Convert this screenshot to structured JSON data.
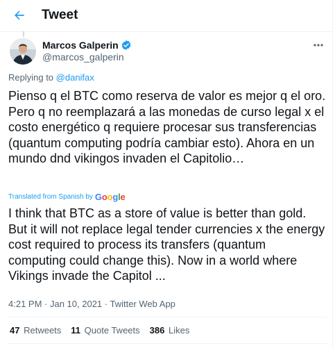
{
  "header": {
    "title": "Tweet"
  },
  "author": {
    "name": "Marcos Galperin",
    "handle": "@marcos_galperin"
  },
  "replying": {
    "prefix": "Replying to ",
    "handle": "@danifax"
  },
  "tweet": {
    "text": "Pienso q el BTC como reserva de valor es mejor q el oro. Pero q no reemplazará a las monedas de curso legal x el costo energético q requiere procesar sus transferencias (quantum computing podría cambiar esto). Ahora en un mundo dnd vikingos invaden el Capitolio…"
  },
  "translation": {
    "label": "Translated from Spanish by",
    "provider": "Google",
    "text": "I think that BTC as a store of value is better than gold. But it will not replace legal tender currencies x the energy cost required to process its transfers (quantum computing could change this). Now in a world where Vikings invade the Capitol ..."
  },
  "meta": {
    "time": "4:21 PM",
    "sep1": " · ",
    "date": "Jan 10, 2021",
    "sep2": " · ",
    "source": "Twitter Web App"
  },
  "stats": [
    {
      "count": "47",
      "label": "Retweets"
    },
    {
      "count": "11",
      "label": "Quote Tweets"
    },
    {
      "count": "386",
      "label": "Likes"
    }
  ],
  "colors": {
    "accent": "#1d9bf0",
    "text": "#0f1419",
    "muted": "#536471",
    "border": "#eff3f4"
  },
  "icons": {
    "back": "arrow-left-icon",
    "verified": "verified-badge-icon",
    "more": "more-icon"
  }
}
